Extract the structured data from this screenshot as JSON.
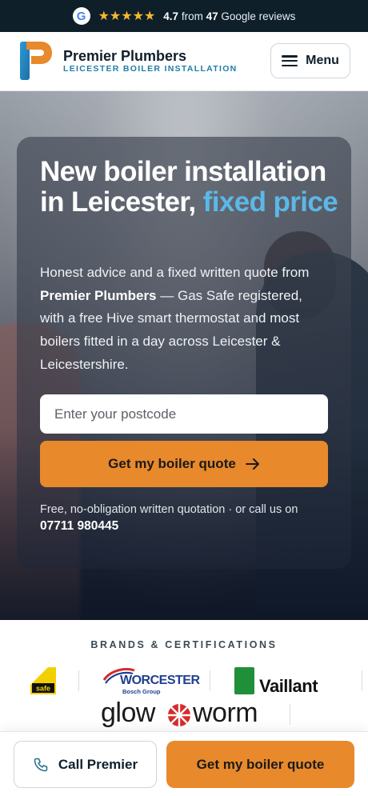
{
  "reviews_bar": {
    "rating": "4.7",
    "from_text": "from",
    "count": "47",
    "suffix": "Google reviews",
    "stars": "★★★★★"
  },
  "header": {
    "brand_name": "Premier Plumbers",
    "brand_tagline": "LEICESTER BOILER INSTALLATION",
    "menu_label": "Menu"
  },
  "hero": {
    "title_part1": "New boiler installation in Leicester,",
    "title_accent": "fixed price",
    "body_part1": "Honest advice and a fixed written quote from",
    "body_bold": "Premier Plumbers",
    "body_part2": "— Gas Safe registered, with a free Hive smart thermostat and most boilers fitted in a day across Leicester & Leicestershire.",
    "postcode_placeholder": "Enter your postcode",
    "cta_label": "Get my boiler quote",
    "note": "Free, no-obligation written quotation · or call us on",
    "phone": "07711 980445"
  },
  "brands": {
    "heading": "BRANDS & CERTIFICATIONS",
    "worcester": "WORCESTER",
    "worcester_sub": "Bosch Group",
    "vaillant": "Vaillant",
    "glowworm_left": "glow",
    "glowworm_right": "worm"
  },
  "sticky_bar": {
    "call_label": "Call Premier",
    "quote_label": "Get my boiler quote"
  },
  "colors": {
    "accent_orange": "#e8892b",
    "accent_blue": "#5bb8e8",
    "dark_navy": "#0e1f2a"
  }
}
